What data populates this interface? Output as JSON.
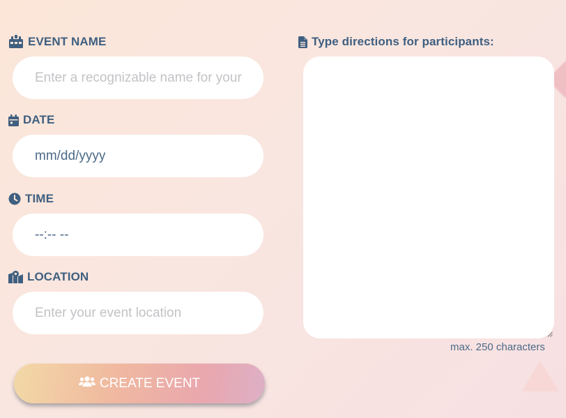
{
  "event_name": {
    "label": "EVENT NAME",
    "icon": "calendar-gift-icon",
    "placeholder": "Enter a recognizable name for your",
    "value": ""
  },
  "date": {
    "label": "DATE",
    "icon": "calendar-icon",
    "value": "mm/dd/yyyy"
  },
  "time": {
    "label": "TIME",
    "icon": "clock-icon",
    "value": "--:-- --"
  },
  "location": {
    "label": "LOCATION",
    "icon": "map-marker-icon",
    "placeholder": "Enter your event location",
    "value": ""
  },
  "directions": {
    "label": "Type directions for participants:",
    "icon": "document-icon",
    "hint": "max. 250 characters",
    "value": ""
  },
  "create_button": {
    "label": "CREATE EVENT",
    "icon": "users-icon"
  },
  "colors": {
    "label_text": "#3f5f80",
    "placeholder_text": "#c3c3c7",
    "button_text": "#ffffff",
    "background": "#fbe6d8"
  }
}
